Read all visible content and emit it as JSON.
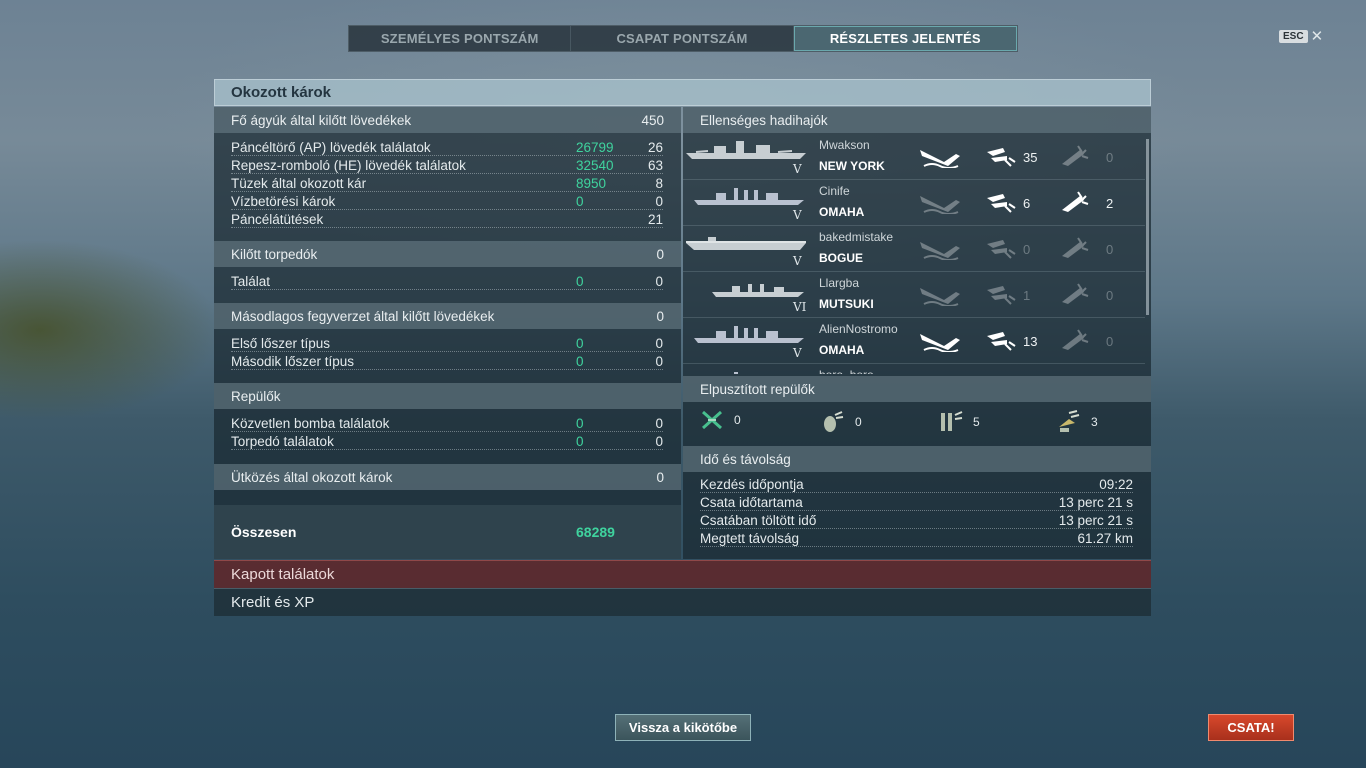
{
  "tabs": [
    {
      "label": "SZEMÉLYES PONTSZÁM"
    },
    {
      "label": "CSAPAT PONTSZÁM"
    },
    {
      "label": "RÉSZLETES JELENTÉS"
    }
  ],
  "esc": {
    "key": "ESC",
    "close": "✕"
  },
  "panel_title": "Okozott károk",
  "left": {
    "main_guns": {
      "header": "Fő ágyúk által kilőtt lövedékek",
      "header_value": "450",
      "rows": [
        {
          "label": "Páncéltörő (AP) lövedék találatok",
          "green": "26799",
          "value": "26"
        },
        {
          "label": "Repesz-romboló (HE) lövedék találatok",
          "green": "32540",
          "value": "63"
        },
        {
          "label": "Tüzek által okozott kár",
          "green": "8950",
          "value": "8"
        },
        {
          "label": "Vízbetörési károk",
          "green": "0",
          "value": "0"
        },
        {
          "label": "Páncélátütések",
          "green": "",
          "value": "21"
        }
      ]
    },
    "torpedoes": {
      "header": "Kilőtt torpedók",
      "header_value": "0",
      "rows": [
        {
          "label": "Találat",
          "green": "0",
          "value": "0"
        }
      ]
    },
    "secondary": {
      "header": "Másodlagos fegyverzet által kilőtt lövedékek",
      "header_value": "0",
      "rows": [
        {
          "label": "Első lőszer típus",
          "green": "0",
          "value": "0"
        },
        {
          "label": "Második lőszer típus",
          "green": "0",
          "value": "0"
        }
      ]
    },
    "aircraft": {
      "header": "Repülők",
      "header_value": "",
      "rows": [
        {
          "label": "Közvetlen bomba találatok",
          "green": "0",
          "value": "0"
        },
        {
          "label": "Torpedó találatok",
          "green": "0",
          "value": "0"
        }
      ]
    },
    "collision": {
      "header": "Ütközés által okozott károk",
      "header_value": "0"
    },
    "total": {
      "label": "Összesen",
      "value": "68289"
    }
  },
  "right": {
    "enemy_header": "Ellenséges hadihajók",
    "ships": [
      {
        "player": "Mwakson",
        "ship": "NEW YORK",
        "tier": "V",
        "hull": "battleship",
        "sunk": true,
        "hits1": "35",
        "hits1_active": true,
        "hits2": "0",
        "hits2_active": false
      },
      {
        "player": "Cinife",
        "ship": "OMAHA",
        "tier": "V",
        "hull": "cruiser",
        "sunk": false,
        "hits1": "6",
        "hits1_active": true,
        "hits2": "2",
        "hits2_active": true
      },
      {
        "player": "bakedmistake",
        "ship": "BOGUE",
        "tier": "V",
        "hull": "carrier",
        "sunk": false,
        "hits1": "0",
        "hits1_active": false,
        "hits2": "0",
        "hits2_active": false
      },
      {
        "player": "Llargba",
        "ship": "MUTSUKI",
        "tier": "VI",
        "hull": "destroyer",
        "sunk": false,
        "hits1": "1",
        "hits1_active": false,
        "hits2": "0",
        "hits2_active": false
      },
      {
        "player": "AlienNostromo",
        "ship": "OMAHA",
        "tier": "V",
        "hull": "cruiser",
        "sunk": true,
        "hits1": "13",
        "hits1_active": true,
        "hits2": "0",
        "hits2_active": false
      },
      {
        "player": "boro_boro",
        "ship": "",
        "tier": "",
        "hull": "cruiser",
        "sunk": true,
        "hits1": "",
        "hits1_active": true,
        "hits2": "",
        "hits2_active": true
      }
    ],
    "planes_header": "Elpusztított repülők",
    "planes": [
      {
        "icon": "fighter-icon",
        "value": "0"
      },
      {
        "icon": "bomb-icon",
        "value": "0"
      },
      {
        "icon": "torpedo-bomber-icon",
        "value": "5"
      },
      {
        "icon": "dive-bomber-icon",
        "value": "3"
      }
    ],
    "time_header": "Idő és távolság",
    "time_rows": [
      {
        "label": "Kezdés időpontja",
        "value": "09:22"
      },
      {
        "label": "Csata időtartama",
        "value": "13 perc 21 s"
      },
      {
        "label": "Csatában töltött idő",
        "value": "13 perc 21 s"
      },
      {
        "label": "Megtett távolság",
        "value": "61.27 km"
      }
    ]
  },
  "received_hits": "Kapott találatok",
  "credits_xp": "Kredit és XP",
  "buttons": {
    "back": "Vissza a kikötőbe",
    "battle": "CSATA!"
  },
  "colors": {
    "accent_green": "#3fd39e",
    "battle_red": "#c03c22"
  }
}
